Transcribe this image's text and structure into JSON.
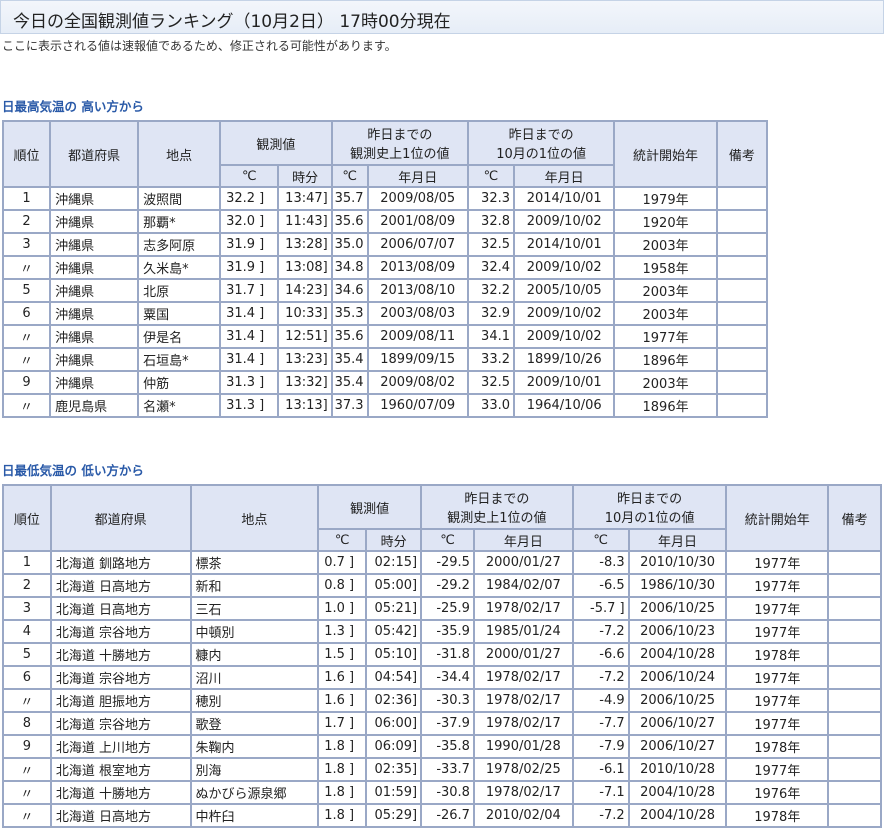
{
  "page": {
    "title": "今日の全国観測値ランキング（10月2日） 17時00分現在",
    "note": "ここに表示される値は速報値であるため、修正される可能性があります。"
  },
  "headers": {
    "rank": "順位",
    "pref": "都道府県",
    "place": "地点",
    "observed": "観測値",
    "record1": "昨日までの",
    "record2": "観測史上1位の値",
    "month1": "昨日までの",
    "month2": "10月の1位の値",
    "start": "統計開始年",
    "remarks": "備考",
    "celsius": "℃",
    "time": "時分",
    "date": "年月日"
  },
  "high": {
    "title": "日最高気温の 高い方から",
    "rows": [
      {
        "rank": "1",
        "pref": "沖縄県",
        "place": "波照間",
        "val": "32.2 ]",
        "time": "13:47]",
        "rec": "35.7",
        "rec_date": "2009/08/05",
        "mon": "32.3",
        "mon_date": "2014/10/01",
        "start": "1979年",
        "remarks": ""
      },
      {
        "rank": "2",
        "pref": "沖縄県",
        "place": "那覇*",
        "val": "32.0 ]",
        "time": "11:43]",
        "rec": "35.6",
        "rec_date": "2001/08/09",
        "mon": "32.8",
        "mon_date": "2009/10/02",
        "start": "1920年",
        "remarks": ""
      },
      {
        "rank": "3",
        "pref": "沖縄県",
        "place": "志多阿原",
        "val": "31.9 ]",
        "time": "13:28]",
        "rec": "35.0",
        "rec_date": "2006/07/07",
        "mon": "32.5",
        "mon_date": "2014/10/01",
        "start": "2003年",
        "remarks": ""
      },
      {
        "rank": "〃",
        "pref": "沖縄県",
        "place": "久米島*",
        "val": "31.9 ]",
        "time": "13:08]",
        "rec": "34.8",
        "rec_date": "2013/08/09",
        "mon": "32.4",
        "mon_date": "2009/10/02",
        "start": "1958年",
        "remarks": ""
      },
      {
        "rank": "5",
        "pref": "沖縄県",
        "place": "北原",
        "val": "31.7 ]",
        "time": "14:23]",
        "rec": "34.6",
        "rec_date": "2013/08/10",
        "mon": "32.2",
        "mon_date": "2005/10/05",
        "start": "2003年",
        "remarks": ""
      },
      {
        "rank": "6",
        "pref": "沖縄県",
        "place": "粟国",
        "val": "31.4 ]",
        "time": "10:33]",
        "rec": "35.3",
        "rec_date": "2003/08/03",
        "mon": "32.9",
        "mon_date": "2009/10/02",
        "start": "2003年",
        "remarks": ""
      },
      {
        "rank": "〃",
        "pref": "沖縄県",
        "place": "伊是名",
        "val": "31.4 ]",
        "time": "12:51]",
        "rec": "35.6",
        "rec_date": "2009/08/11",
        "mon": "34.1",
        "mon_date": "2009/10/02",
        "start": "1977年",
        "remarks": ""
      },
      {
        "rank": "〃",
        "pref": "沖縄県",
        "place": "石垣島*",
        "val": "31.4 ]",
        "time": "13:23]",
        "rec": "35.4",
        "rec_date": "1899/09/15",
        "mon": "33.2",
        "mon_date": "1899/10/26",
        "start": "1896年",
        "remarks": ""
      },
      {
        "rank": "9",
        "pref": "沖縄県",
        "place": "仲筋",
        "val": "31.3 ]",
        "time": "13:32]",
        "rec": "35.4",
        "rec_date": "2009/08/02",
        "mon": "32.5",
        "mon_date": "2009/10/01",
        "start": "2003年",
        "remarks": ""
      },
      {
        "rank": "〃",
        "pref": "鹿児島県",
        "place": "名瀬*",
        "val": "31.3 ]",
        "time": "13:13]",
        "rec": "37.3",
        "rec_date": "1960/07/09",
        "mon": "33.0",
        "mon_date": "1964/10/06",
        "start": "1896年",
        "remarks": ""
      }
    ]
  },
  "low": {
    "title": "日最低気温の 低い方から",
    "rows": [
      {
        "rank": "1",
        "pref": "北海道 釧路地方",
        "place": "標茶",
        "val": "0.7 ]",
        "time": "02:15]",
        "rec": "-29.5",
        "rec_date": "2000/01/27",
        "mon": "-8.3",
        "mon_date": "2010/10/30",
        "start": "1977年",
        "remarks": ""
      },
      {
        "rank": "2",
        "pref": "北海道 日高地方",
        "place": "新和",
        "val": "0.8 ]",
        "time": "05:00]",
        "rec": "-29.2",
        "rec_date": "1984/02/07",
        "mon": "-6.5",
        "mon_date": "1986/10/30",
        "start": "1977年",
        "remarks": ""
      },
      {
        "rank": "3",
        "pref": "北海道 日高地方",
        "place": "三石",
        "val": "1.0 ]",
        "time": "05:21]",
        "rec": "-25.9",
        "rec_date": "1978/02/17",
        "mon": "-5.7 ]",
        "mon_date": "2006/10/25",
        "start": "1977年",
        "remarks": ""
      },
      {
        "rank": "4",
        "pref": "北海道 宗谷地方",
        "place": "中頓別",
        "val": "1.3 ]",
        "time": "05:42]",
        "rec": "-35.9",
        "rec_date": "1985/01/24",
        "mon": "-7.2",
        "mon_date": "2006/10/23",
        "start": "1977年",
        "remarks": ""
      },
      {
        "rank": "5",
        "pref": "北海道 十勝地方",
        "place": "糠内",
        "val": "1.5 ]",
        "time": "05:10]",
        "rec": "-31.8",
        "rec_date": "2000/01/27",
        "mon": "-6.6",
        "mon_date": "2004/10/28",
        "start": "1978年",
        "remarks": ""
      },
      {
        "rank": "6",
        "pref": "北海道 宗谷地方",
        "place": "沼川",
        "val": "1.6 ]",
        "time": "04:54]",
        "rec": "-34.4",
        "rec_date": "1978/02/17",
        "mon": "-7.2",
        "mon_date": "2006/10/24",
        "start": "1977年",
        "remarks": ""
      },
      {
        "rank": "〃",
        "pref": "北海道 胆振地方",
        "place": "穂別",
        "val": "1.6 ]",
        "time": "02:36]",
        "rec": "-30.3",
        "rec_date": "1978/02/17",
        "mon": "-4.9",
        "mon_date": "2006/10/25",
        "start": "1977年",
        "remarks": ""
      },
      {
        "rank": "8",
        "pref": "北海道 宗谷地方",
        "place": "歌登",
        "val": "1.7 ]",
        "time": "06:00]",
        "rec": "-37.9",
        "rec_date": "1978/02/17",
        "mon": "-7.7",
        "mon_date": "2006/10/27",
        "start": "1977年",
        "remarks": ""
      },
      {
        "rank": "9",
        "pref": "北海道 上川地方",
        "place": "朱鞠内",
        "val": "1.8 ]",
        "time": "06:09]",
        "rec": "-35.8",
        "rec_date": "1990/01/28",
        "mon": "-7.9",
        "mon_date": "2006/10/27",
        "start": "1978年",
        "remarks": ""
      },
      {
        "rank": "〃",
        "pref": "北海道 根室地方",
        "place": "別海",
        "val": "1.8 ]",
        "time": "02:35]",
        "rec": "-33.7",
        "rec_date": "1978/02/25",
        "mon": "-6.1",
        "mon_date": "2010/10/28",
        "start": "1977年",
        "remarks": ""
      },
      {
        "rank": "〃",
        "pref": "北海道 十勝地方",
        "place": "ぬかびら源泉郷",
        "val": "1.8 ]",
        "time": "01:59]",
        "rec": "-30.8",
        "rec_date": "1978/02/17",
        "mon": "-7.1",
        "mon_date": "2004/10/28",
        "start": "1976年",
        "remarks": ""
      },
      {
        "rank": "〃",
        "pref": "北海道 日高地方",
        "place": "中杵臼",
        "val": "1.8 ]",
        "time": "05:29]",
        "rec": "-26.7",
        "rec_date": "2010/02/04",
        "mon": "-7.2",
        "mon_date": "2004/10/28",
        "start": "1978年",
        "remarks": ""
      }
    ]
  }
}
